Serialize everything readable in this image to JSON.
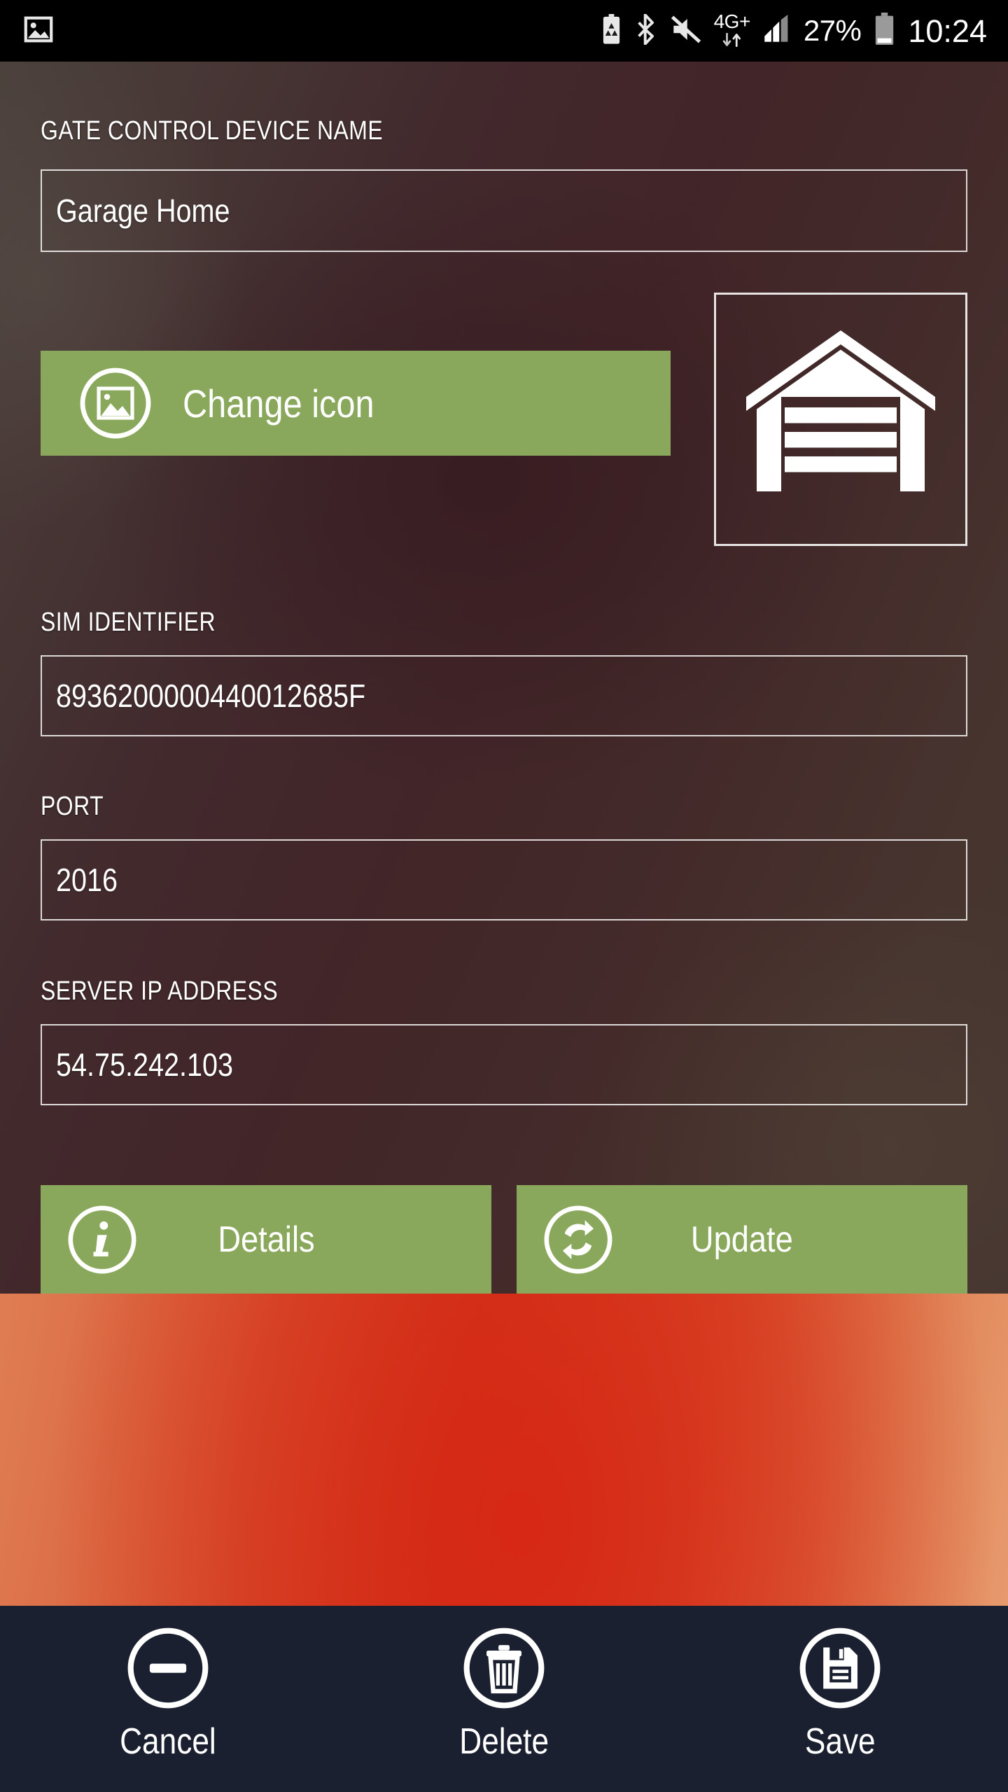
{
  "status_bar": {
    "gallery_icon": "image-icon",
    "battery_saver_icon": "battery-saver-icon",
    "bluetooth_icon": "bluetooth-icon",
    "mute_icon": "volume-mute-icon",
    "network_label": "4G+",
    "data_arrows_icon": "data-transfer-icon",
    "signal_icon": "signal-bars-icon",
    "battery_percent": "27%",
    "battery_icon": "battery-icon",
    "clock": "10:24"
  },
  "form": {
    "device_name": {
      "label": "GATE CONTROL DEVICE NAME",
      "value": "Garage Home"
    },
    "change_icon": {
      "label": "Change icon",
      "icon": "photo-icon"
    },
    "icon_preview": {
      "icon": "garage-icon"
    },
    "sim_identifier": {
      "label": "SIM IDENTIFIER",
      "value": "8936200000440012685F"
    },
    "port": {
      "label": "PORT",
      "value": "2016"
    },
    "server_ip": {
      "label": "SERVER IP ADDRESS",
      "value": "54.75.242.103"
    },
    "actions": [
      {
        "label": "Details",
        "icon": "info-icon"
      },
      {
        "label": "Update",
        "icon": "sync-icon"
      }
    ]
  },
  "bottom_nav": [
    {
      "label": "Cancel",
      "icon": "minus-circle-icon"
    },
    {
      "label": "Delete",
      "icon": "trash-icon"
    },
    {
      "label": "Save",
      "icon": "floppy-disk-icon"
    }
  ],
  "colors": {
    "accent_green": "#8aa85c",
    "bottom_bar": "#1b2030",
    "status_bar": "#000000",
    "text": "#ffffff"
  }
}
